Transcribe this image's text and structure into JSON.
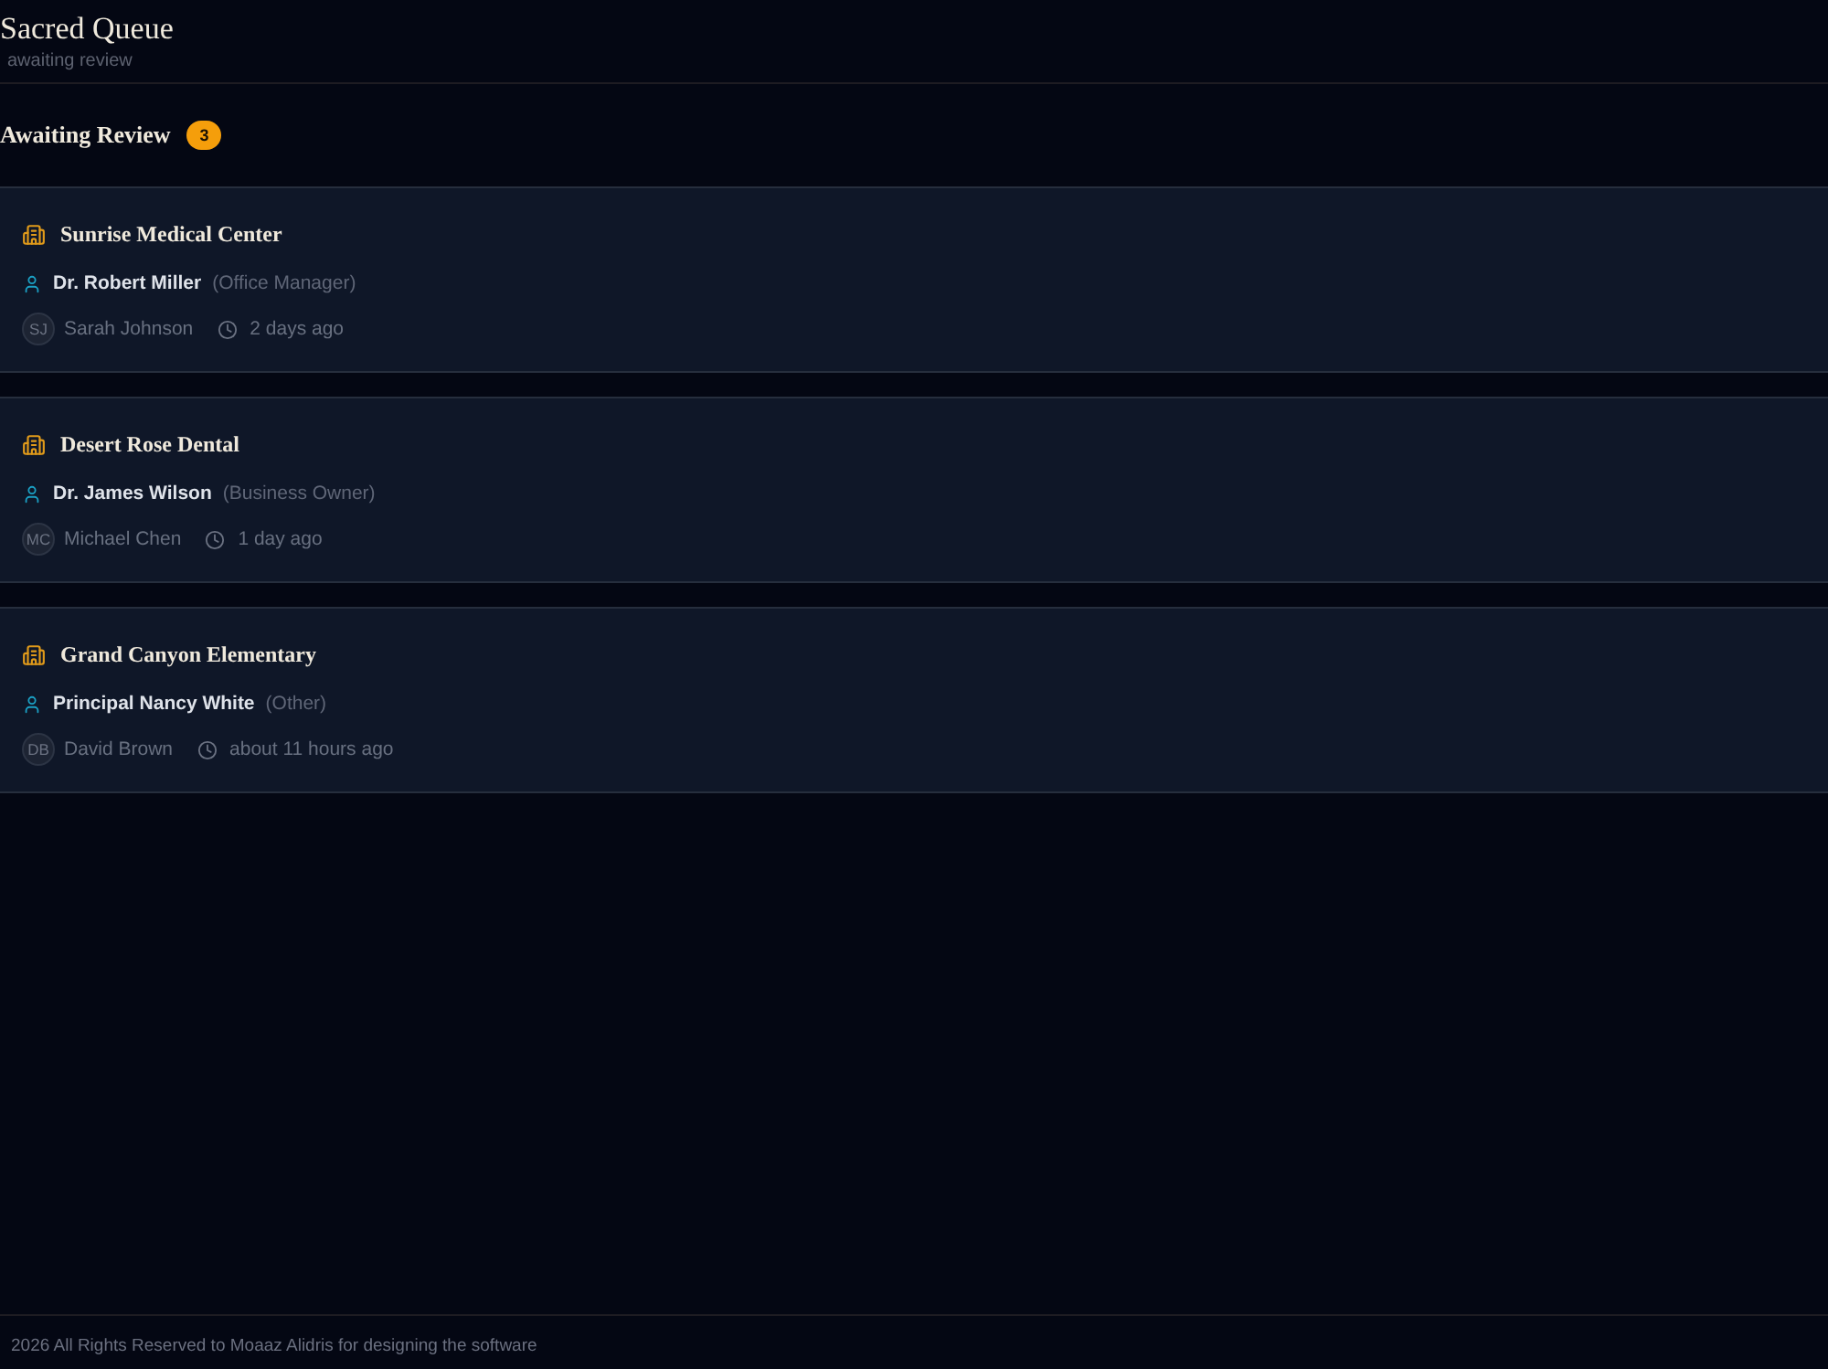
{
  "header": {
    "title": "Sacred Queue",
    "subtitle": "awaiting review"
  },
  "section": {
    "title": "Awaiting Review",
    "count": "3"
  },
  "requests": [
    {
      "organization": "Sunrise Medical Center",
      "contact": "Dr. Robert Miller",
      "role": "(Office Manager)",
      "submitter_initials": "SJ",
      "submitter": "Sarah Johnson",
      "time": "2 days ago"
    },
    {
      "organization": "Desert Rose Dental",
      "contact": "Dr. James Wilson",
      "role": "(Business Owner)",
      "submitter_initials": "MC",
      "submitter": "Michael Chen",
      "time": "1 day ago"
    },
    {
      "organization": "Grand Canyon Elementary",
      "contact": "Principal Nancy White",
      "role": "(Other)",
      "submitter_initials": "DB",
      "submitter": "David Brown",
      "time": "about 11 hours ago"
    }
  ],
  "footer": {
    "text": "2026 All Rights Reserved to Moaaz Alidris for designing the software"
  }
}
